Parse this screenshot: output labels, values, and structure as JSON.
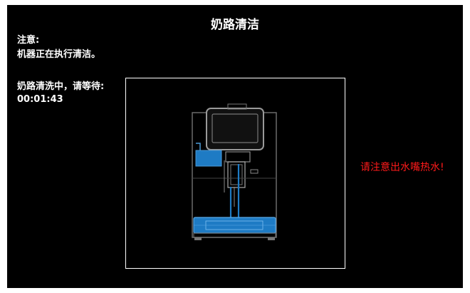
{
  "header": {
    "title": "奶路清洁"
  },
  "notice": {
    "heading": "注意:",
    "message": "机器正在执行清洁。"
  },
  "status": {
    "label": "奶路清洗中，请等待:",
    "timer": "00:01:43"
  },
  "warning": {
    "text": "请注意出水嘴热水!"
  },
  "illustration": {
    "icon": "coffee-machine-illustration"
  },
  "colors": {
    "background": "#000000",
    "text": "#ffffff",
    "warning": "#ff1a1a",
    "water": "#1e7bc4",
    "outline": "#9a9a9a"
  }
}
